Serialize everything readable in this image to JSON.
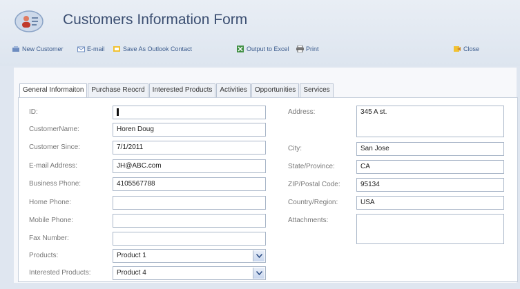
{
  "header": {
    "title": "Customers Information Form"
  },
  "toolbar": {
    "items": [
      {
        "label": "New Customer",
        "icon": "new-customer-icon"
      },
      {
        "label": "E-mail",
        "icon": "email-icon"
      },
      {
        "label": "Save As Outlook Contact",
        "icon": "outlook-contact-icon"
      },
      {
        "label": "Output to Excel",
        "icon": "excel-icon"
      },
      {
        "label": "Print",
        "icon": "print-icon"
      },
      {
        "label": "Close",
        "icon": "close-icon"
      }
    ]
  },
  "tabs": [
    {
      "label": "General Informaiton",
      "active": true
    },
    {
      "label": "Purchase Reocrd"
    },
    {
      "label": "Interested Products"
    },
    {
      "label": "Activities"
    },
    {
      "label": "Opportunities"
    },
    {
      "label": "Services"
    }
  ],
  "form": {
    "left": [
      {
        "label": "ID:",
        "value": ""
      },
      {
        "label": "CustomerName:",
        "value": "Horen Doug"
      },
      {
        "label": "Customer Since:",
        "value": "7/1/2011"
      },
      {
        "label": "E-mail Address:",
        "value": "JH@ABC.com"
      },
      {
        "label": "Business Phone:",
        "value": "4105567788"
      },
      {
        "label": "Home Phone:",
        "value": ""
      },
      {
        "label": "Mobile Phone:",
        "value": ""
      },
      {
        "label": "Fax Number:",
        "value": ""
      },
      {
        "label": "Products:",
        "value": "Product 1"
      },
      {
        "label": "Interested Products:",
        "value": "Product 4"
      }
    ],
    "right": [
      {
        "label": "Address:",
        "value": "345 A st."
      },
      {
        "label": "City:",
        "value": "San Jose"
      },
      {
        "label": "State/Province:",
        "value": "CA"
      },
      {
        "label": "ZIP/Postal Code:",
        "value": "95134"
      },
      {
        "label": "Country/Region:",
        "value": "USA"
      },
      {
        "label": "Attachments:",
        "value": ""
      }
    ]
  }
}
